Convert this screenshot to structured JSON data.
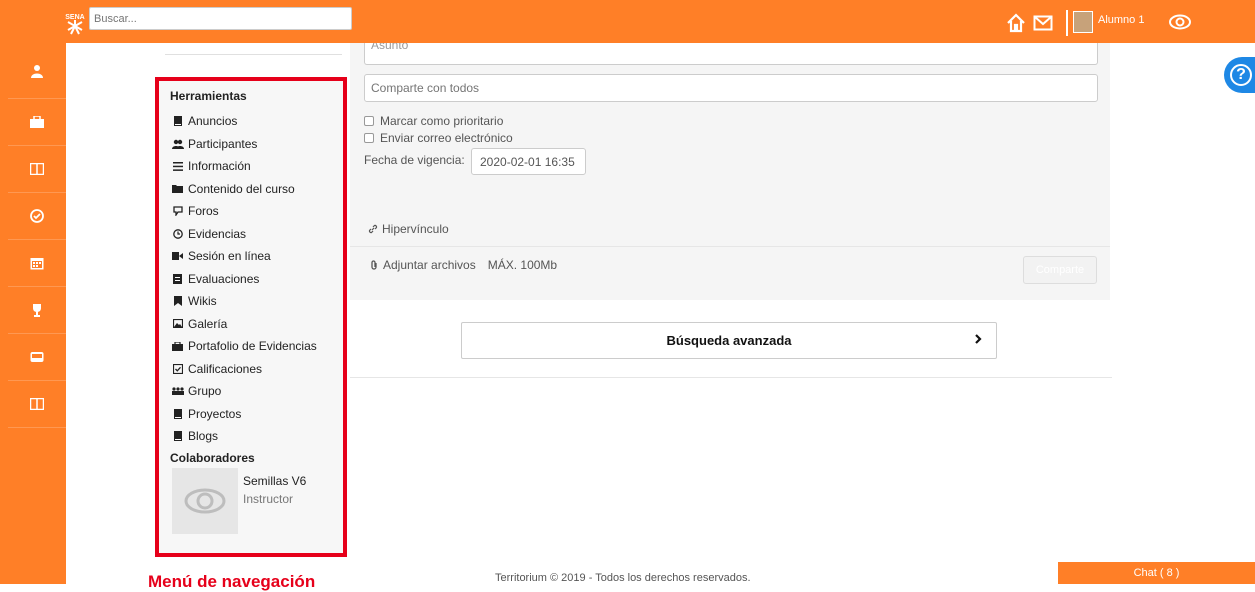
{
  "header": {
    "search_placeholder": "Buscar...",
    "user_name": "Alumno 1",
    "icons": [
      "sena-logo",
      "home-icon",
      "mail-icon",
      "avatar",
      "eye-icon"
    ]
  },
  "sidenav": {
    "icons": [
      "user-icon",
      "briefcase-icon",
      "book-icon",
      "check-circle-icon",
      "calendar-icon",
      "trophy-icon",
      "inbox-icon",
      "book-icon"
    ]
  },
  "tools": {
    "title": "Herramientas",
    "items": [
      {
        "label": "Anuncios",
        "icon": "book-icon"
      },
      {
        "label": "Participantes",
        "icon": "users-icon"
      },
      {
        "label": "Información",
        "icon": "list-icon"
      },
      {
        "label": "Contenido del curso",
        "icon": "folder-icon"
      },
      {
        "label": "Foros",
        "icon": "forum-icon"
      },
      {
        "label": "Evidencias",
        "icon": "clock-icon"
      },
      {
        "label": "Sesión en línea",
        "icon": "video-icon"
      },
      {
        "label": "Evaluaciones",
        "icon": "clipboard-icon"
      },
      {
        "label": "Wikis",
        "icon": "bookmark-icon"
      },
      {
        "label": "Galería",
        "icon": "image-icon"
      },
      {
        "label": "Portafolio de Evidencias",
        "icon": "briefcase-icon"
      },
      {
        "label": "Calificaciones",
        "icon": "check-square-icon"
      },
      {
        "label": "Grupo",
        "icon": "group-icon"
      },
      {
        "label": "Proyectos",
        "icon": "book-icon"
      },
      {
        "label": "Blogs",
        "icon": "book-icon"
      }
    ],
    "collab_title": "Colaboradores",
    "collab_name": "Semillas V6",
    "collab_role": "Instructor",
    "caption": "Menú de navegación"
  },
  "composer": {
    "subject_placeholder": "Asunto",
    "share_placeholder": "Comparte con todos",
    "priority_label": "Marcar como prioritario",
    "email_label": "Enviar correo electrónico",
    "date_label": "Fecha de vigencia:",
    "date_value": "2020-02-01 16:35",
    "link_label": "Hipervínculo",
    "attach_label": "Adjuntar archivos",
    "max_size": "MÁX. 100Mb",
    "share_button": "Comparte"
  },
  "advanced_search": "Búsqueda avanzada",
  "footer": "Territorium © 2019 - Todos los derechos reservados.",
  "chat": "Chat ( 8 )",
  "colors": {
    "brand": "#ff7f27",
    "highlight": "#e6001a",
    "help": "#1e88e5"
  }
}
